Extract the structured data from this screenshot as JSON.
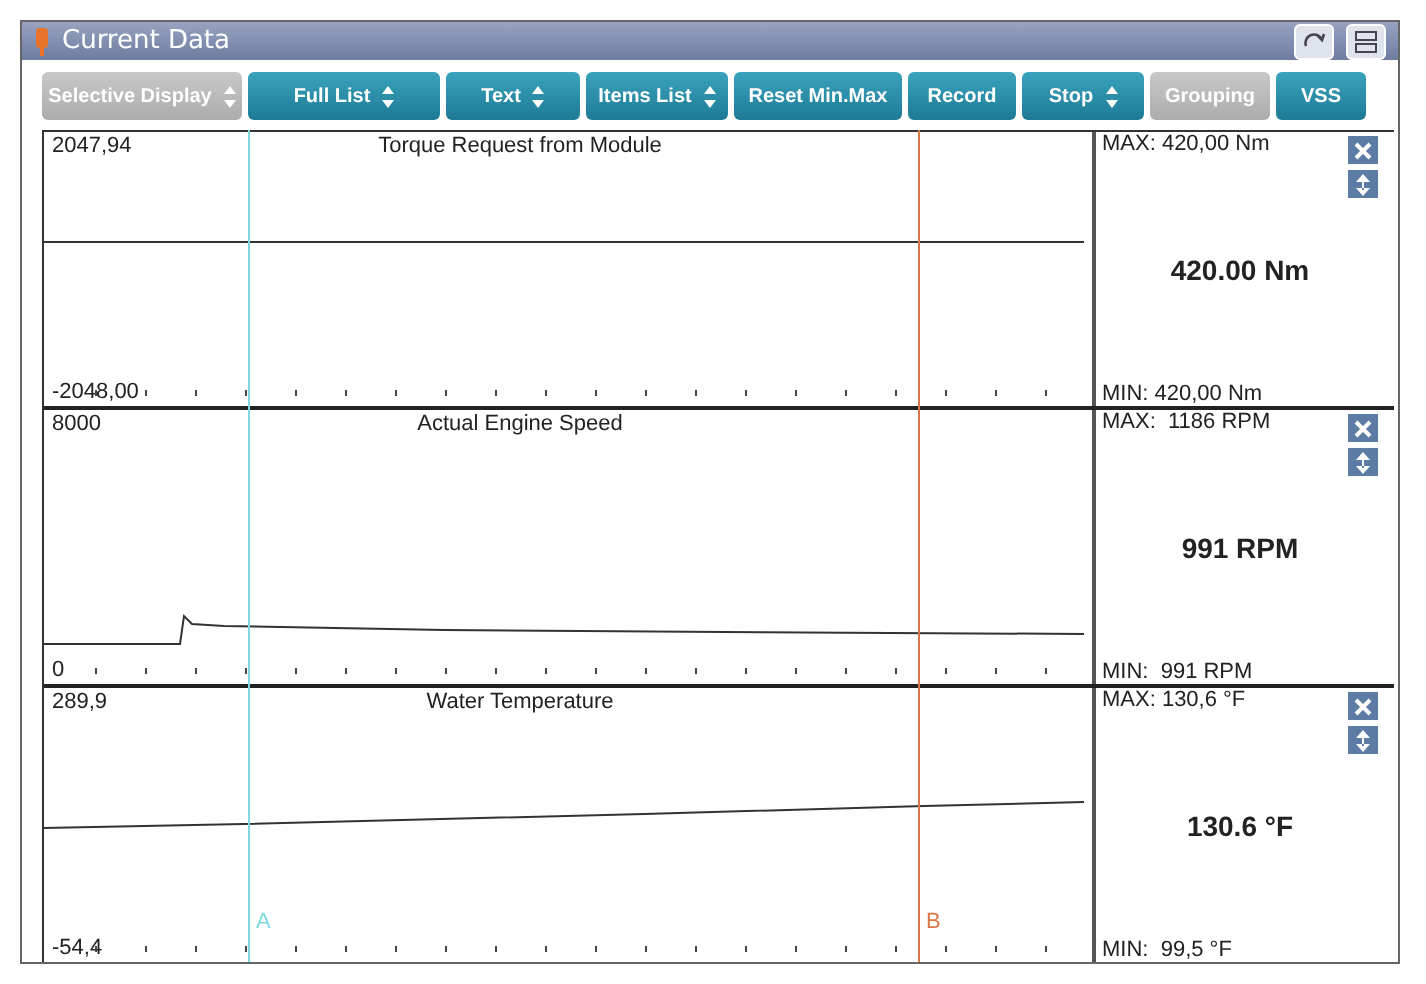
{
  "window": {
    "title": "Current Data"
  },
  "toolbar": [
    {
      "label": "Selective Display",
      "kind": "dropdown",
      "disabled": true
    },
    {
      "label": "Full List",
      "kind": "dropdown",
      "disabled": false
    },
    {
      "label": "Text",
      "kind": "dropdown",
      "disabled": false
    },
    {
      "label": "Items List",
      "kind": "dropdown",
      "disabled": false
    },
    {
      "label": "Reset Min.Max",
      "kind": "plain",
      "disabled": false
    },
    {
      "label": "Record",
      "kind": "plain",
      "disabled": false
    },
    {
      "label": "Stop",
      "kind": "dropdown",
      "disabled": false
    },
    {
      "label": "Grouping",
      "kind": "plain",
      "disabled": true
    },
    {
      "label": "VSS",
      "kind": "plain",
      "disabled": false
    }
  ],
  "graphs": [
    {
      "title": "Torque Request from Module",
      "y_max": "2047,94",
      "y_min": "-2048,00",
      "kind": "flat",
      "max": "MAX: 420,00 Nm",
      "value": "420.00 Nm",
      "min": "MIN: 420,00 Nm"
    },
    {
      "title": "Actual Engine Speed",
      "y_max": "8000",
      "y_min": "0",
      "kind": "step",
      "max": "MAX:  1186 RPM",
      "value": "991 RPM",
      "min": "MIN:  991 RPM"
    },
    {
      "title": "Water Temperature",
      "y_max": "289,9",
      "y_min": "-54,4",
      "kind": "ramp",
      "max": "MAX: 130,6 °F",
      "value": "130.6 °F",
      "min": "MIN:  99,5 °F"
    }
  ],
  "cursors": [
    {
      "label": "A",
      "color": "#7fd8e0"
    },
    {
      "label": "B",
      "color": "#d8784a"
    }
  ]
}
